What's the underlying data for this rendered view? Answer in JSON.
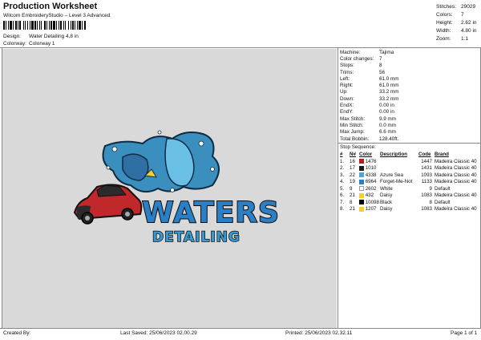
{
  "header": {
    "title": "Production Worksheet",
    "subtitle": "Wilcom EmbroideryStudio – Level 3 Advanced",
    "design_label": "Design:",
    "design_value": "Water Detailing 4,8 in",
    "colorway_label": "Colorway:",
    "colorway_value": "Colorway 1"
  },
  "stats": [
    {
      "label": "Stitches:",
      "value": "29029"
    },
    {
      "label": "Colors:",
      "value": "7"
    },
    {
      "label": "Height:",
      "value": "2.62 in"
    },
    {
      "label": "Width:",
      "value": "4.80 in"
    },
    {
      "label": "Zoom:",
      "value": "1:1"
    }
  ],
  "properties": [
    {
      "label": "Machine:",
      "value": "Tajima"
    },
    {
      "label": "Color changes:",
      "value": "7"
    },
    {
      "label": "Stops:",
      "value": "8"
    },
    {
      "label": "Trims:",
      "value": "56"
    },
    {
      "label": "Left:",
      "value": "61.0 mm"
    },
    {
      "label": "Right:",
      "value": "61.0 mm"
    },
    {
      "label": "Up:",
      "value": "33.2 mm"
    },
    {
      "label": "Down:",
      "value": "33.2 mm"
    },
    {
      "label": "EndX:",
      "value": "0.00 in"
    },
    {
      "label": "EndY:",
      "value": "0.00 in"
    },
    {
      "label": "Max Stitch:",
      "value": "9.9 mm"
    },
    {
      "label": "Min Stitch:",
      "value": "0.0 mm"
    },
    {
      "label": "Max Jump:",
      "value": "6.6 mm"
    },
    {
      "label": "Total Bobbin:",
      "value": "128.40ft."
    }
  ],
  "sequence": {
    "title": "Stop Sequence:",
    "headers": [
      "#",
      "N#",
      "Color",
      "Description",
      "Code",
      "Brand"
    ],
    "rows": [
      {
        "num": "1.",
        "n": "16",
        "hex": "#b51f24",
        "color": "1476",
        "desc": "",
        "code": "1447",
        "brand": "Madeira Classic 40"
      },
      {
        "num": "2.",
        "n": "17",
        "hex": "#1b1b1b",
        "color": "1010",
        "desc": "",
        "code": "1431",
        "brand": "Madeira Classic 40"
      },
      {
        "num": "3.",
        "n": "22",
        "hex": "#4aa7d6",
        "color": "4338",
        "desc": "Azure Sea",
        "code": "1093",
        "brand": "Madeira Classic 40"
      },
      {
        "num": "4.",
        "n": "19",
        "hex": "#2b7fc4",
        "color": "6964",
        "desc": "Forget-Me-Not",
        "code": "1133",
        "brand": "Madeira Classic 40"
      },
      {
        "num": "5.",
        "n": "9",
        "hex": "#ffffff",
        "color": "2602",
        "desc": "White",
        "code": "9",
        "brand": "Default"
      },
      {
        "num": "6.",
        "n": "21",
        "hex": "#f3d02c",
        "color": "432",
        "desc": "Daisy",
        "code": "1083",
        "brand": "Madeira Classic 40"
      },
      {
        "num": "7.",
        "n": "8",
        "hex": "#000000",
        "color": "10098",
        "desc": "Black",
        "code": "8",
        "brand": "Default"
      },
      {
        "num": "8.",
        "n": "21",
        "hex": "#f3d02c",
        "color": "1207",
        "desc": "Daisy",
        "code": "1083",
        "brand": "Madeira Classic 40"
      }
    ]
  },
  "footer": {
    "created_by": "Created By:",
    "last_saved": "Last Saved: 25/06/2023 02.00.29",
    "printed": "Printed: 25/06/2023 02.32.11",
    "page": "Page 1 of 1"
  },
  "artwork": {
    "line1": "WATERS",
    "line2": "DETAILING"
  }
}
